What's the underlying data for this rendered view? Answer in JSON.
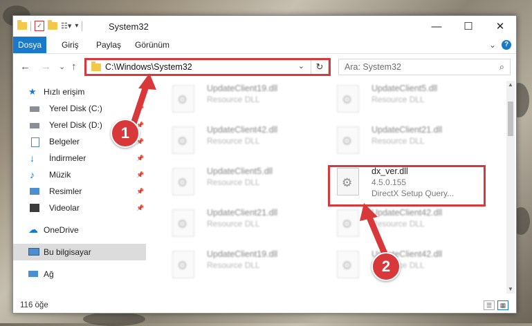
{
  "window": {
    "title": "System32",
    "minimize_label": "—",
    "maximize_label": "☐",
    "close_label": "✕"
  },
  "ribbon": {
    "tabs": [
      "Dosya",
      "Giriş",
      "Paylaş",
      "Görünüm"
    ],
    "collapse_label": "⌄",
    "help_label": "?"
  },
  "nav": {
    "back": "←",
    "forward": "→",
    "recent": "⌄",
    "up": "↑",
    "address": "C:\\Windows\\System32",
    "address_dropdown": "⌄",
    "refresh": "↻",
    "search_placeholder": "Ara: System32",
    "search_icon": "⌕"
  },
  "sidebar": {
    "items": [
      {
        "label": "Hızlı erişim",
        "icon": "star-icon"
      },
      {
        "label": "Yerel Disk (C:)",
        "icon": "drive-icon",
        "pinned": true
      },
      {
        "label": "Yerel Disk (D:)",
        "icon": "drive-icon",
        "pinned": true
      },
      {
        "label": "Belgeler",
        "icon": "documents-icon",
        "pinned": true
      },
      {
        "label": "İndirmeler",
        "icon": "downloads-icon",
        "pinned": true
      },
      {
        "label": "Müzik",
        "icon": "music-icon",
        "pinned": true
      },
      {
        "label": "Resimler",
        "icon": "pictures-icon",
        "pinned": true
      },
      {
        "label": "Videolar",
        "icon": "videos-icon",
        "pinned": true
      },
      {
        "label": "OneDrive",
        "icon": "cloud-icon"
      },
      {
        "label": "Bu bilgisayar",
        "icon": "computer-icon",
        "selected": true
      },
      {
        "label": "Ağ",
        "icon": "network-icon"
      }
    ],
    "pin_glyph": "📌"
  },
  "files": [
    {
      "name": "UpdateClient19.dll",
      "desc": "Resource DLL"
    },
    {
      "name": "UpdateClient5.dll",
      "desc": "Resource DLL"
    },
    {
      "name": "UpdateClient42.dll",
      "desc": "Resource DLL"
    },
    {
      "name": "UpdateClient21.dll",
      "desc": "Resource DLL"
    },
    {
      "name": "UpdateClient5.dll",
      "desc": "Resource DLL"
    },
    {
      "name": "dx_ver.dll",
      "desc": "4.5.0.155",
      "desc2": "DirectX Setup Query..."
    },
    {
      "name": "UpdateClient21.dll",
      "desc": "Resource DLL"
    },
    {
      "name": "UpdateClient42.dll",
      "desc": "Resource DLL"
    },
    {
      "name": "UpdateClient19.dll",
      "desc": "Resource DLL"
    },
    {
      "name": "UpdateClient42.dll",
      "desc": "Resource DLL"
    }
  ],
  "status": {
    "count": "116 öğe"
  },
  "callouts": [
    "1",
    "2"
  ],
  "colors": {
    "accent": "#1979ca",
    "highlight": "#d9383a"
  }
}
